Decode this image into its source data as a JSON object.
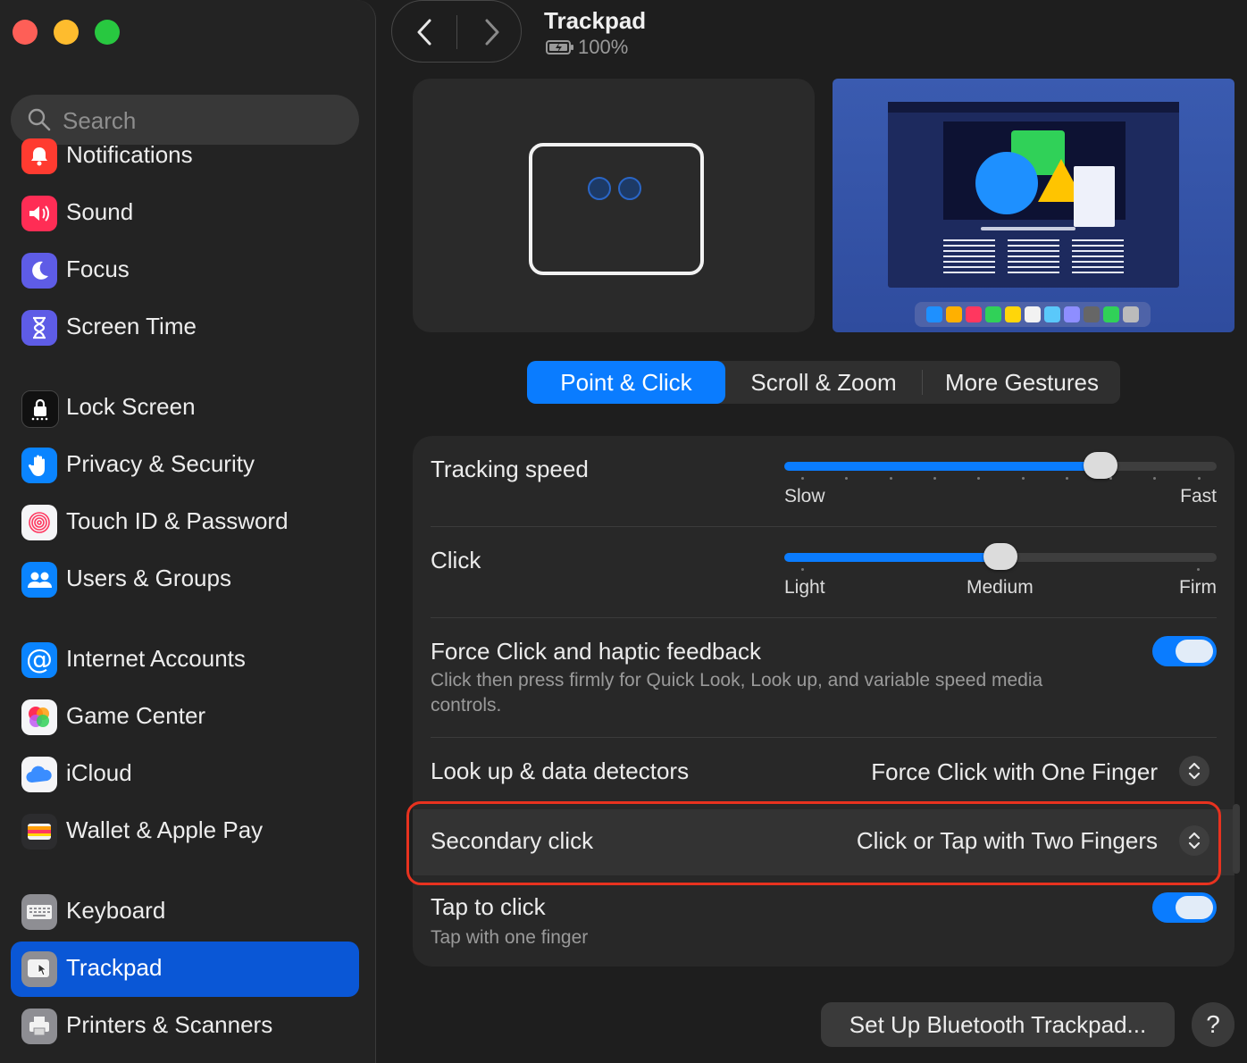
{
  "window": {
    "title": "Trackpad",
    "battery": "100%"
  },
  "search": {
    "placeholder": "Search"
  },
  "sidebar": {
    "items": [
      {
        "label": "Notifications",
        "color": "#ff3b30"
      },
      {
        "label": "Sound",
        "color": "#ff2d55"
      },
      {
        "label": "Focus",
        "color": "#5e5ce6"
      },
      {
        "label": "Screen Time",
        "color": "#5e5ce6"
      },
      {
        "label": "Lock Screen",
        "color": "#1c1c1e"
      },
      {
        "label": "Privacy & Security",
        "color": "#0a84ff"
      },
      {
        "label": "Touch ID & Password",
        "color": "#f2f2f7"
      },
      {
        "label": "Users & Groups",
        "color": "#0a84ff"
      },
      {
        "label": "Internet Accounts",
        "color": "#0a84ff"
      },
      {
        "label": "Game Center",
        "color": "#f2f2f7"
      },
      {
        "label": "iCloud",
        "color": "#f2f2f7"
      },
      {
        "label": "Wallet & Apple Pay",
        "color": "#2c2c2e"
      },
      {
        "label": "Keyboard",
        "color": "#8e8e93"
      },
      {
        "label": "Trackpad",
        "color": "#8e8e93"
      },
      {
        "label": "Printers & Scanners",
        "color": "#8e8e93"
      }
    ],
    "active": "Trackpad"
  },
  "tabs": [
    {
      "label": "Point & Click",
      "active": true
    },
    {
      "label": "Scroll & Zoom",
      "active": false
    },
    {
      "label": "More Gestures",
      "active": false
    }
  ],
  "settings": {
    "tracking": {
      "label": "Tracking speed",
      "min_label": "Slow",
      "max_label": "Fast",
      "value_fraction": 0.75
    },
    "click": {
      "label": "Click",
      "low": "Light",
      "mid": "Medium",
      "high": "Firm",
      "value_fraction": 0.5
    },
    "force_click": {
      "label": "Force Click and haptic feedback",
      "description": "Click then press firmly for Quick Look, Look up, and variable speed media controls.",
      "enabled": true
    },
    "lookup": {
      "label": "Look up & data detectors",
      "value": "Force Click with One Finger"
    },
    "secondary": {
      "label": "Secondary click",
      "value": "Click or Tap with Two Fingers"
    },
    "tap_to_click": {
      "label": "Tap to click",
      "description": "Tap with one finger",
      "enabled": true
    }
  },
  "buttons": {
    "bluetooth": "Set Up Bluetooth Trackpad...",
    "help": "?"
  },
  "colors": {
    "accent": "#0a7cff",
    "sidebar_active": "#0a57d6",
    "highlight": "#e8321f"
  }
}
